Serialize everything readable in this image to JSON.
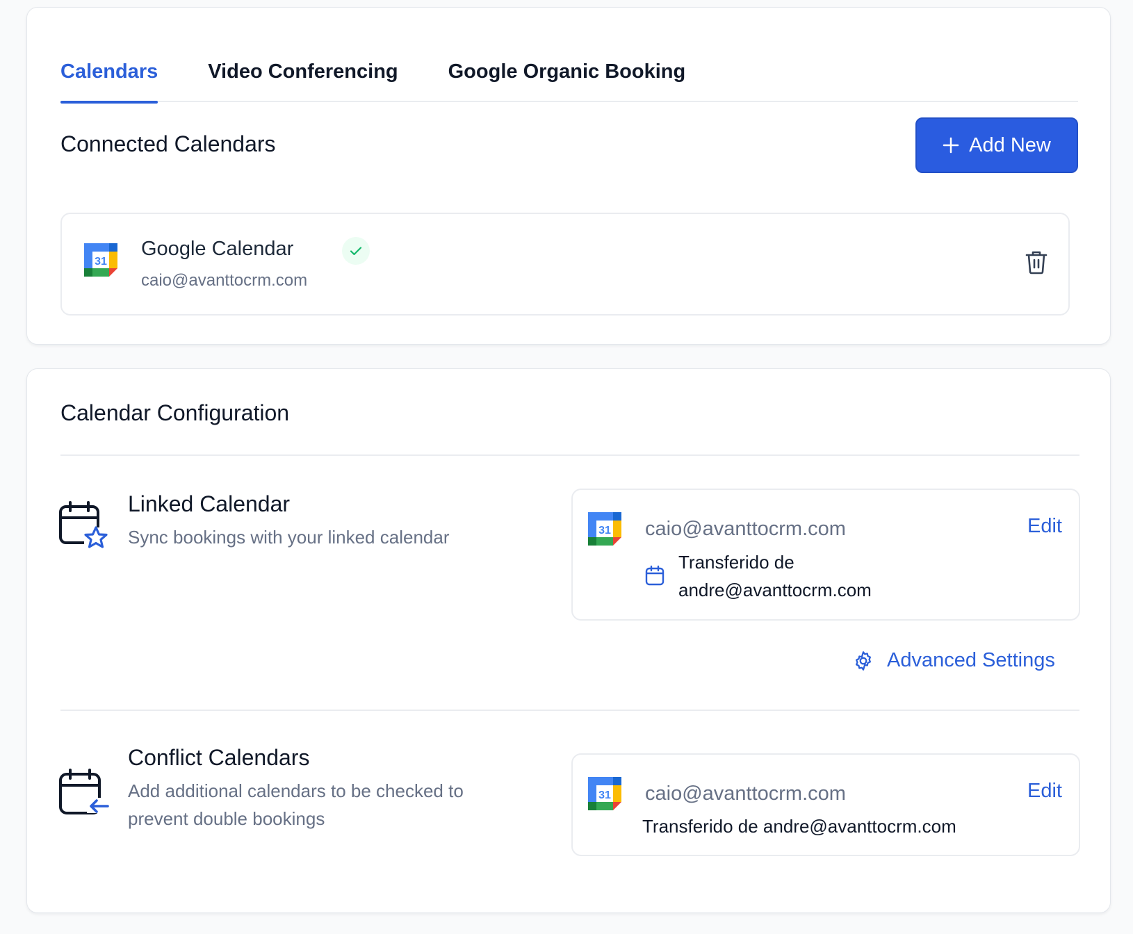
{
  "tabs": [
    {
      "label": "Calendars",
      "active": true
    },
    {
      "label": "Video Conferencing",
      "active": false
    },
    {
      "label": "Google Organic Booking",
      "active": false
    }
  ],
  "connected": {
    "title": "Connected Calendars",
    "add_button_label": "Add New",
    "items": [
      {
        "name": "Google Calendar",
        "email": "caio@avanttocrm.com",
        "status": "connected",
        "icon": "google-calendar-icon"
      }
    ]
  },
  "config": {
    "title": "Calendar Configuration",
    "linked": {
      "title": "Linked Calendar",
      "description": "Sync bookings with your linked calendar",
      "email": "caio@avanttocrm.com",
      "edit_label": "Edit",
      "sub_calendar": "Transferido de andre@avanttocrm.com",
      "advanced_settings_label": "Advanced Settings"
    },
    "conflict": {
      "title": "Conflict Calendars",
      "description": "Add additional calendars to be checked to prevent double bookings",
      "email": "caio@avanttocrm.com",
      "edit_label": "Edit",
      "sub_calendar": "Transferido de andre@avanttocrm.com"
    }
  },
  "colors": {
    "accent": "#2b5fd9",
    "button": "#2a5ce0",
    "success": "#12b76a",
    "muted_text": "#667085"
  }
}
